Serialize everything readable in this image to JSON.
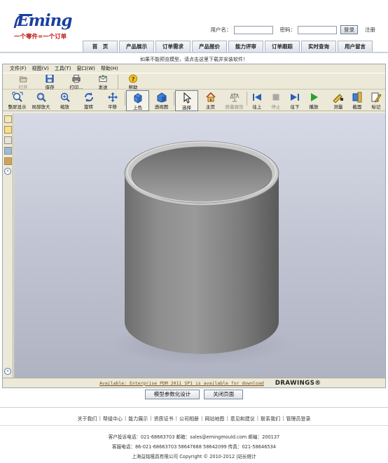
{
  "brand": {
    "logo_text": "Eming",
    "slogan": "一个零件=一个订单"
  },
  "login": {
    "username_label": "用户名：",
    "password_label": "密码：",
    "login_button": "登录",
    "register_link": "注册"
  },
  "nav": [
    "首　页",
    "产品展示",
    "订单需求",
    "产品报价",
    "能力评审",
    "订单跟踪",
    "实时查询",
    "用户留言"
  ],
  "notice": "如果不能预览模型，请点击这里下载并安装软件！",
  "viewer": {
    "menu": [
      "文件(F)",
      "视图(V)",
      "工具(T)",
      "窗口(W)",
      "帮助(H)"
    ],
    "toolbar1": [
      {
        "label": "打开",
        "icon": "open-icon"
      },
      {
        "label": "保存",
        "icon": "save-icon"
      },
      {
        "label": "打印...",
        "icon": "print-icon"
      },
      {
        "label": "发送",
        "icon": "send-icon"
      },
      {
        "label": "帮助",
        "icon": "help-icon"
      }
    ],
    "toolbar2": [
      {
        "label": "整屏显示",
        "icon": "zoom-fit-icon"
      },
      {
        "label": "局部放大",
        "icon": "zoom-area-icon"
      },
      {
        "label": "缩放",
        "icon": "zoom-icon"
      },
      {
        "label": "旋转",
        "icon": "rotate-icon"
      },
      {
        "label": "平移",
        "icon": "pan-icon"
      },
      {
        "label": "上色",
        "icon": "shaded-icon"
      },
      {
        "label": "透视图",
        "icon": "perspective-icon"
      },
      {
        "label": "选择",
        "icon": "select-icon"
      },
      {
        "label": "主页",
        "icon": "home-icon"
      },
      {
        "label": "质量属性",
        "icon": "mass-properties-icon"
      },
      {
        "label": "往上",
        "icon": "previous-icon"
      },
      {
        "label": "停止",
        "icon": "stop-icon"
      },
      {
        "label": "往下",
        "icon": "next-icon"
      },
      {
        "label": "播放",
        "icon": "play-icon"
      },
      {
        "label": "测量",
        "icon": "measure-icon"
      },
      {
        "label": "截面",
        "icon": "section-icon"
      },
      {
        "label": "标记",
        "icon": "markup-icon"
      }
    ],
    "status_message": "Available: Enterprise PDM 2011 SP1 is available for download",
    "status_brand": "DRAWINGS®"
  },
  "actions": {
    "design_button": "模型参数化设计",
    "close_button": "关闭页面"
  },
  "footer": {
    "links": [
      "关于我们",
      "帮组中心",
      "能力展示",
      "资质证书",
      "公司相册",
      "网站地图",
      "意见和建议",
      "联系我们",
      "管理员登录"
    ],
    "complaint_line": "客户投诉电话：021-68663703 邮箱：sales@emingmould.com 邮编：200137",
    "service_line": "客服电话：86-021-68663703 58647688 58642099 传真：021-58646534",
    "copyright_line": "上海益铭模具有限公司 Copyright © 2010-2012 |站长统计"
  }
}
